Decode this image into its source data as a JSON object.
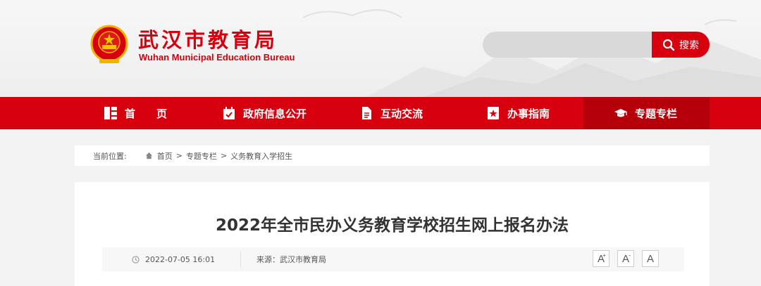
{
  "header": {
    "title": "武汉市教育局",
    "subtitle": "Wuhan Municipal Education Bureau",
    "emblem_icon": "national-emblem",
    "brand_color": "#d7000f"
  },
  "search": {
    "placeholder": "",
    "button_label": "搜索",
    "icon": "search-icon"
  },
  "nav": {
    "items": [
      {
        "label": "首　　页",
        "icon": "home-grid-icon"
      },
      {
        "label": "政府信息公开",
        "icon": "calendar-check-icon"
      },
      {
        "label": "互动交流",
        "icon": "document-icon"
      },
      {
        "label": "办事指南",
        "icon": "star-bookmark-icon"
      },
      {
        "label": "专题专栏",
        "icon": "graduation-cap-icon",
        "active": true
      }
    ],
    "active_color": "#b5000c"
  },
  "breadcrumb": {
    "label": "当前位置:",
    "items": [
      "首页",
      "专题专栏",
      "义务教育入学招生"
    ],
    "separator": ">"
  },
  "article": {
    "title": "2022年全市民办义务教育学校招生网上报名办法",
    "datetime": "2022-07-05 16:01",
    "source": "来源：武汉市教育局",
    "font_buttons": [
      "A",
      "A",
      "A"
    ]
  }
}
